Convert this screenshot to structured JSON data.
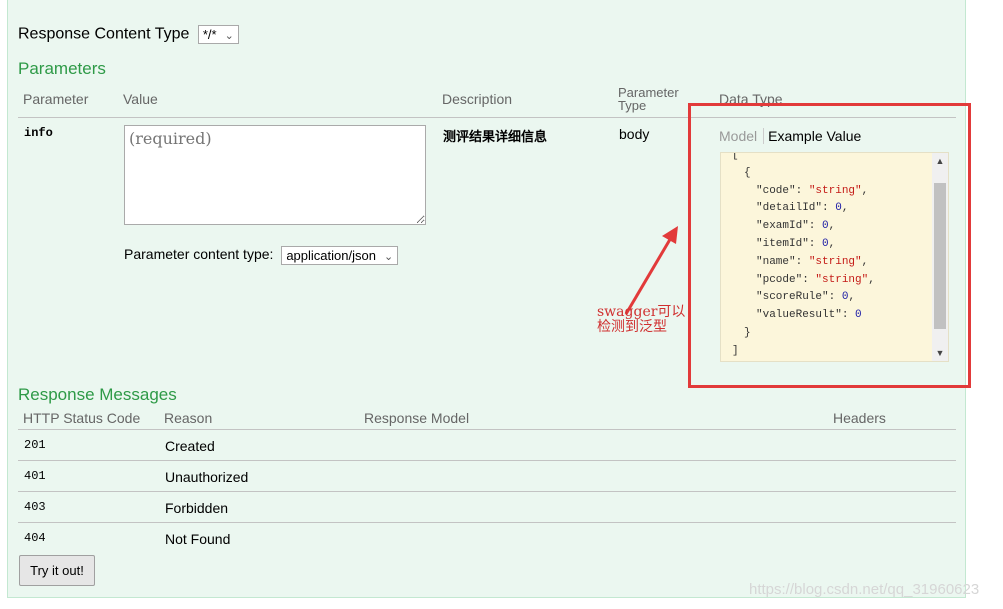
{
  "response_content_type": {
    "label": "Response Content Type",
    "value": "*/*"
  },
  "parameters": {
    "heading": "Parameters",
    "headers": {
      "parameter": "Parameter",
      "value": "Value",
      "description": "Description",
      "parameter_type_line1": "Parameter",
      "parameter_type_line2": "Type",
      "data_type": "Data Type"
    },
    "row": {
      "name": "info",
      "value_placeholder": "(required)",
      "description": "测评结果详细信息",
      "param_type": "body",
      "content_type_label": "Parameter content type:",
      "content_type_value": "application/json"
    },
    "data_type_tabs": {
      "model": "Model",
      "example": "Example Value"
    },
    "example_json": {
      "open_bracket": "[",
      "open_brace": "{",
      "fields": [
        {
          "key": "\"code\"",
          "value": "\"string\"",
          "kind": "string",
          "comma": ","
        },
        {
          "key": "\"detailId\"",
          "value": "0",
          "kind": "number",
          "comma": ","
        },
        {
          "key": "\"examId\"",
          "value": "0",
          "kind": "number",
          "comma": ","
        },
        {
          "key": "\"itemId\"",
          "value": "0",
          "kind": "number",
          "comma": ","
        },
        {
          "key": "\"name\"",
          "value": "\"string\"",
          "kind": "string",
          "comma": ","
        },
        {
          "key": "\"pcode\"",
          "value": "\"string\"",
          "kind": "string",
          "comma": ","
        },
        {
          "key": "\"scoreRule\"",
          "value": "0",
          "kind": "number",
          "comma": ","
        },
        {
          "key": "\"valueResult\"",
          "value": "0",
          "kind": "number",
          "comma": ""
        }
      ],
      "close_brace": "}",
      "close_bracket": "]"
    }
  },
  "annotation": {
    "line1": "swagger可以",
    "line2": "检测到泛型",
    "color": "#d03030"
  },
  "response_messages": {
    "heading": "Response Messages",
    "headers": {
      "status": "HTTP Status Code",
      "reason": "Reason",
      "model": "Response Model",
      "headers": "Headers"
    },
    "rows": [
      {
        "code": "201",
        "reason": "Created"
      },
      {
        "code": "401",
        "reason": "Unauthorized"
      },
      {
        "code": "403",
        "reason": "Forbidden"
      },
      {
        "code": "404",
        "reason": "Not Found"
      }
    ]
  },
  "try_button": "Try it out!",
  "watermark": "https://blog.csdn.net/qq_31960623",
  "colors": {
    "heading_green": "#2e9a47",
    "panel_bg": "#ebf7f0",
    "json_bg": "#fcf6db",
    "highlight_red": "#e23a3a"
  }
}
